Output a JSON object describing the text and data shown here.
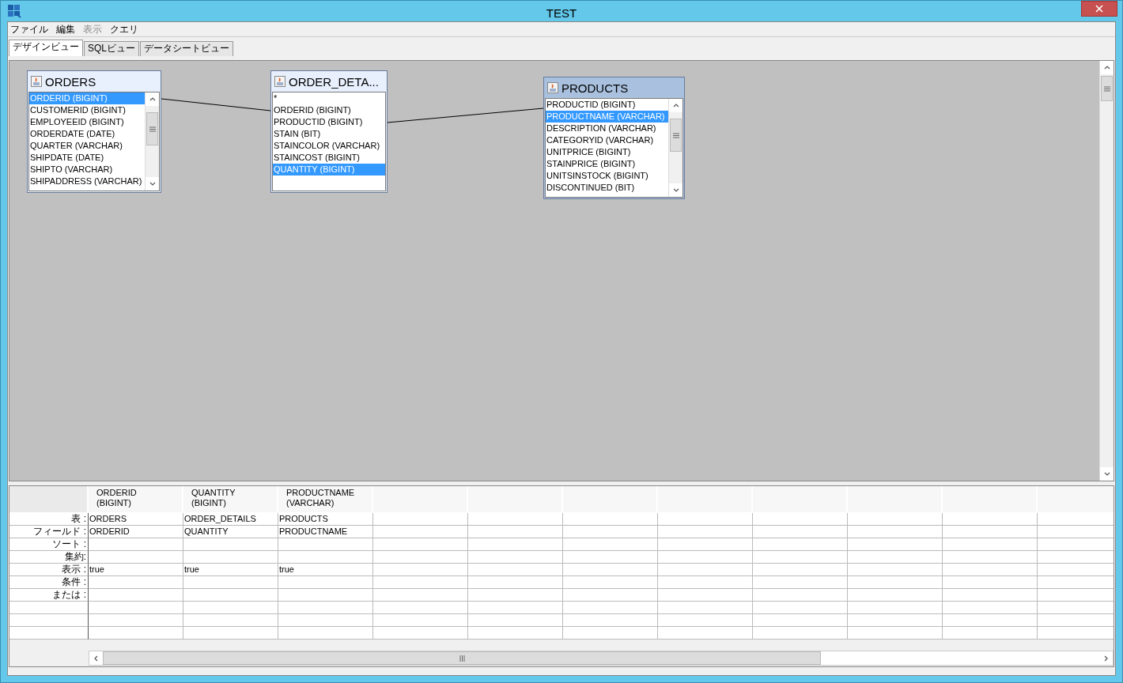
{
  "window": {
    "title": "TEST"
  },
  "menu": [
    {
      "label": "ファイル",
      "disabled": false
    },
    {
      "label": "編集",
      "disabled": false
    },
    {
      "label": "表示",
      "disabled": true
    },
    {
      "label": "クエリ",
      "disabled": false
    }
  ],
  "tabs": [
    {
      "label": "デザインビュー",
      "selected": true
    },
    {
      "label": "SQLビュー",
      "selected": false
    },
    {
      "label": "データシートビュー",
      "selected": false
    }
  ],
  "tables": [
    {
      "name": "ORDERS",
      "active": false,
      "scrollbar": true,
      "fields": [
        {
          "label": "ORDERID (BIGINT)",
          "selected": true
        },
        {
          "label": "CUSTOMERID (BIGINT)",
          "selected": false
        },
        {
          "label": "EMPLOYEEID (BIGINT)",
          "selected": false
        },
        {
          "label": "ORDERDATE (DATE)",
          "selected": false
        },
        {
          "label": "QUARTER (VARCHAR)",
          "selected": false
        },
        {
          "label": "SHIPDATE (DATE)",
          "selected": false
        },
        {
          "label": "SHIPTO (VARCHAR)",
          "selected": false
        },
        {
          "label": "SHIPADDRESS (VARCHAR)",
          "selected": false
        }
      ]
    },
    {
      "name": "ORDER_DETA...",
      "active": false,
      "scrollbar": false,
      "fields": [
        {
          "label": "*",
          "selected": false
        },
        {
          "label": "ORDERID (BIGINT)",
          "selected": false
        },
        {
          "label": "PRODUCTID (BIGINT)",
          "selected": false
        },
        {
          "label": "STAIN (BIT)",
          "selected": false
        },
        {
          "label": "STAINCOLOR (VARCHAR)",
          "selected": false
        },
        {
          "label": "STAINCOST (BIGINT)",
          "selected": false
        },
        {
          "label": "QUANTITY (BIGINT)",
          "selected": true
        }
      ]
    },
    {
      "name": "PRODUCTS",
      "active": true,
      "scrollbar": true,
      "fields": [
        {
          "label": "PRODUCTID (BIGINT)",
          "selected": false
        },
        {
          "label": "PRODUCTNAME (VARCHAR)",
          "selected": true
        },
        {
          "label": "DESCRIPTION (VARCHAR)",
          "selected": false
        },
        {
          "label": "CATEGORYID (VARCHAR)",
          "selected": false
        },
        {
          "label": "UNITPRICE (BIGINT)",
          "selected": false
        },
        {
          "label": "STAINPRICE (BIGINT)",
          "selected": false
        },
        {
          "label": "UNITSINSTOCK (BIGINT)",
          "selected": false
        },
        {
          "label": "DISCONTINUED (BIT)",
          "selected": false
        }
      ]
    }
  ],
  "grid": {
    "columns": [
      {
        "header": [
          "ORDERID",
          "(BIGINT)"
        ]
      },
      {
        "header": [
          "QUANTITY",
          "(BIGINT)"
        ]
      },
      {
        "header": [
          "PRODUCTNAME",
          "(VARCHAR)"
        ]
      }
    ],
    "rows": [
      {
        "label": "表 :",
        "cells": [
          "ORDERS",
          "ORDER_DETAILS",
          "PRODUCTS"
        ]
      },
      {
        "label": "フィールド :",
        "cells": [
          "ORDERID",
          "QUANTITY",
          "PRODUCTNAME"
        ]
      },
      {
        "label": "ソート :"
      },
      {
        "label": "集約:"
      },
      {
        "label": "表示 :",
        "cells": [
          "true",
          "true",
          "true"
        ]
      },
      {
        "label": "条件 :"
      },
      {
        "label": "または :"
      },
      {},
      {},
      {}
    ]
  }
}
